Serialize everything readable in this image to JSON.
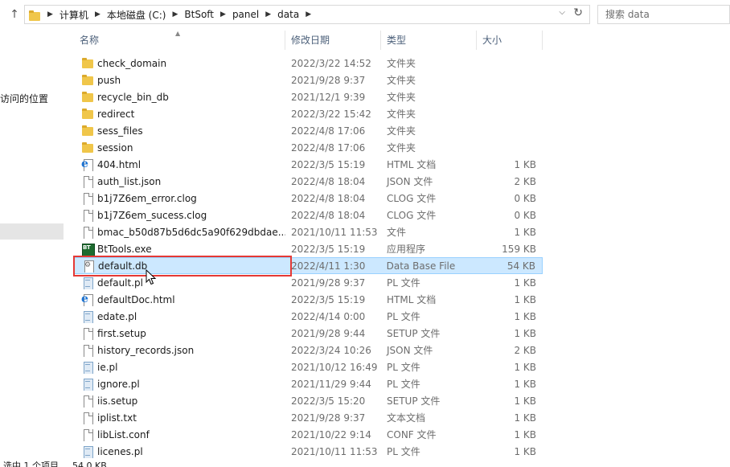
{
  "address": {
    "crumbs": [
      "计算机",
      "本地磁盘 (C:)",
      "BtSoft",
      "panel",
      "data"
    ]
  },
  "search": {
    "placeholder": "搜索 data"
  },
  "nav": {
    "quick_access": "访问的位置"
  },
  "columns": {
    "name": "名称",
    "date": "修改日期",
    "type": "类型",
    "size": "大小"
  },
  "files": [
    {
      "name": "check_domain",
      "date": "2022/3/22 14:52",
      "type": "文件夹",
      "size": "",
      "icon": "folder-icon"
    },
    {
      "name": "push",
      "date": "2021/9/28 9:37",
      "type": "文件夹",
      "size": "",
      "icon": "folder-icon"
    },
    {
      "name": "recycle_bin_db",
      "date": "2021/12/1 9:39",
      "type": "文件夹",
      "size": "",
      "icon": "folder-icon"
    },
    {
      "name": "redirect",
      "date": "2022/3/22 15:42",
      "type": "文件夹",
      "size": "",
      "icon": "folder-icon"
    },
    {
      "name": "sess_files",
      "date": "2022/4/8 17:06",
      "type": "文件夹",
      "size": "",
      "icon": "folder-icon"
    },
    {
      "name": "session",
      "date": "2022/4/8 17:06",
      "type": "文件夹",
      "size": "",
      "icon": "folder-icon"
    },
    {
      "name": "404.html",
      "date": "2022/3/5 15:19",
      "type": "HTML 文档",
      "size": "1 KB",
      "icon": "html-file-icon"
    },
    {
      "name": "auth_list.json",
      "date": "2022/4/8 18:04",
      "type": "JSON 文件",
      "size": "2 KB",
      "icon": "file-icon"
    },
    {
      "name": "b1j7Z6em_error.clog",
      "date": "2022/4/8 18:04",
      "type": "CLOG 文件",
      "size": "0 KB",
      "icon": "file-icon"
    },
    {
      "name": "b1j7Z6em_sucess.clog",
      "date": "2022/4/8 18:04",
      "type": "CLOG 文件",
      "size": "0 KB",
      "icon": "file-icon"
    },
    {
      "name": "bmac_b50d87b5d6dc5a90f629dbdae...",
      "date": "2021/10/11 11:53",
      "type": "文件",
      "size": "1 KB",
      "icon": "file-icon"
    },
    {
      "name": "BtTools.exe",
      "date": "2022/3/5 15:19",
      "type": "应用程序",
      "size": "159 KB",
      "icon": "exe-icon"
    },
    {
      "name": "default.db",
      "date": "2022/4/11 1:30",
      "type": "Data Base File",
      "size": "54 KB",
      "icon": "database-file-icon",
      "selected": true
    },
    {
      "name": "default.pl",
      "date": "2021/9/28 9:37",
      "type": "PL 文件",
      "size": "1 KB",
      "icon": "script-file-icon"
    },
    {
      "name": "defaultDoc.html",
      "date": "2022/3/5 15:19",
      "type": "HTML 文档",
      "size": "1 KB",
      "icon": "html-file-icon"
    },
    {
      "name": "edate.pl",
      "date": "2022/4/14 0:00",
      "type": "PL 文件",
      "size": "1 KB",
      "icon": "script-file-icon"
    },
    {
      "name": "first.setup",
      "date": "2021/9/28 9:44",
      "type": "SETUP 文件",
      "size": "1 KB",
      "icon": "file-icon"
    },
    {
      "name": "history_records.json",
      "date": "2022/3/24 10:26",
      "type": "JSON 文件",
      "size": "2 KB",
      "icon": "file-icon"
    },
    {
      "name": "ie.pl",
      "date": "2021/10/12 16:49",
      "type": "PL 文件",
      "size": "1 KB",
      "icon": "script-file-icon"
    },
    {
      "name": "ignore.pl",
      "date": "2021/11/29 9:44",
      "type": "PL 文件",
      "size": "1 KB",
      "icon": "script-file-icon"
    },
    {
      "name": "iis.setup",
      "date": "2022/3/5 15:20",
      "type": "SETUP 文件",
      "size": "1 KB",
      "icon": "file-icon"
    },
    {
      "name": "iplist.txt",
      "date": "2021/9/28 9:37",
      "type": "文本文档",
      "size": "1 KB",
      "icon": "file-icon"
    },
    {
      "name": "libList.conf",
      "date": "2021/10/22 9:14",
      "type": "CONF 文件",
      "size": "1 KB",
      "icon": "file-icon"
    },
    {
      "name": "licenes.pl",
      "date": "2021/10/11 11:53",
      "type": "PL 文件",
      "size": "1 KB",
      "icon": "script-file-icon"
    }
  ],
  "status": {
    "selection": "选中 1 个项目",
    "size": "54.0 KB"
  },
  "colors": {
    "selection_bg": "#cce8ff",
    "selection_border": "#99d1ff",
    "highlight": "#e53935",
    "header_text": "#4c607a"
  }
}
